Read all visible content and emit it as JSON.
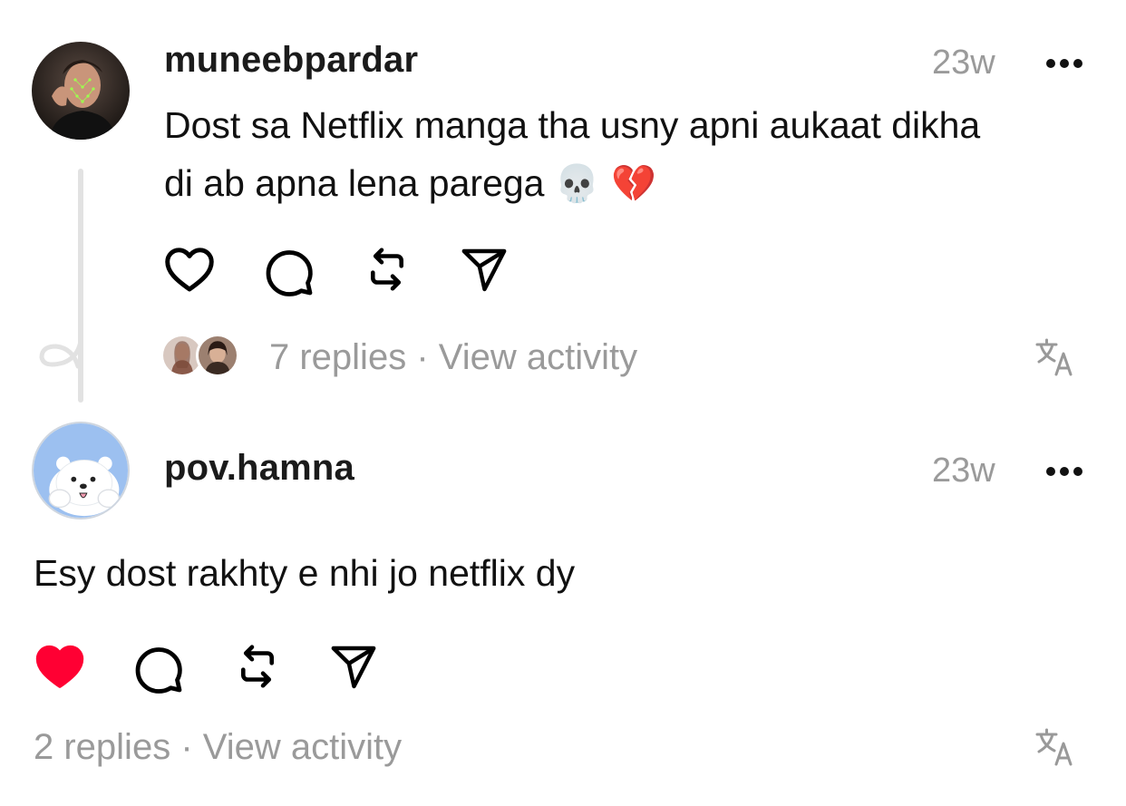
{
  "posts": [
    {
      "username": "muneebpardar",
      "time": "23w",
      "text_line1": "Dost sa Netflix manga tha usny apni aukaat dikha",
      "text_line2": "di ab apna lena parega",
      "emoji": "💀 💔",
      "liked": false,
      "replies_text": "7 replies",
      "separator": "·",
      "activity_text": "View activity"
    },
    {
      "username": "pov.hamna",
      "time": "23w",
      "text": "Esy dost rakhty e nhi jo netflix dy",
      "liked": true,
      "replies_text": "2 replies",
      "separator": "·",
      "activity_text": "View activity"
    }
  ],
  "icons": {
    "like": "heart-icon",
    "comment": "comment-icon",
    "repost": "repost-icon",
    "share": "share-icon",
    "translate": "translate-icon",
    "more": "more-icon"
  },
  "colors": {
    "liked": "#ff0033",
    "muted": "#9a9a9a",
    "thread_line": "#e2e2e2"
  }
}
